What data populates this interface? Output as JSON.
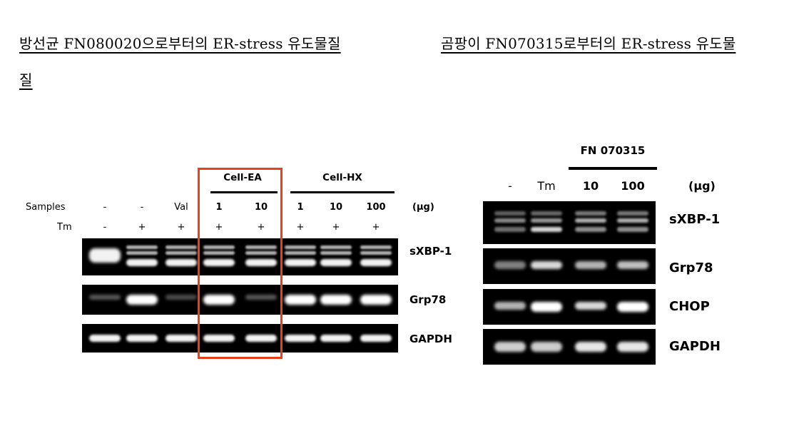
{
  "headings": {
    "left_line1": "방선균 FN080020으로부터의 ER-stress 유도물질",
    "left_line2": "질 ",
    "right_line1": "곰팡이 FN070315로부터의 ER-stress 유도물"
  },
  "left_figure": {
    "row_labels": {
      "samples": "Samples",
      "tm": "Tm"
    },
    "groups": [
      {
        "label": "Cell-EA",
        "highlighted": true
      },
      {
        "label": "Cell-HX",
        "highlighted": false
      }
    ],
    "unit": "(μg)",
    "lanes": [
      {
        "sample": "-",
        "tm": "-"
      },
      {
        "sample": "-",
        "tm": "+"
      },
      {
        "sample": "Val",
        "tm": "+"
      },
      {
        "sample": "1",
        "tm": "+"
      },
      {
        "sample": "10",
        "tm": "+"
      },
      {
        "sample": "1",
        "tm": "+"
      },
      {
        "sample": "10",
        "tm": "+"
      },
      {
        "sample": "100",
        "tm": "+"
      }
    ],
    "genes": [
      "sXBP-1",
      "Grp78",
      "GAPDH"
    ],
    "highlight_color": "#e8401c"
  },
  "right_figure": {
    "group_label": "FN 070315",
    "unit": "(μg)",
    "lanes": [
      "-",
      "Tm",
      "10",
      "100"
    ],
    "genes": [
      "sXBP-1",
      "Grp78",
      "CHOP",
      "GAPDH"
    ]
  }
}
